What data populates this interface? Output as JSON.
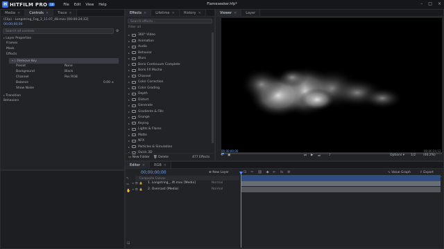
{
  "app": {
    "name": "HITFILM PRO",
    "version": "16",
    "menu": [
      "File",
      "Edit",
      "View",
      "Help"
    ],
    "project_title": "Flameseeker.hfp*"
  },
  "left_panel": {
    "tabs": [
      "Media",
      "Controls",
      "Trace"
    ],
    "clip_name": "(Clip) - Longstring_Fog_3_11.07_48.mov [00:00:24;12]",
    "timecode": "00;00;00;00",
    "search_placeholder": "Search all controls",
    "sections": [
      "Layer Properties",
      "Frames",
      "Mask",
      "Effects"
    ],
    "effect_name": "Remove Key",
    "properties": [
      {
        "label": "Preset",
        "value": "None"
      },
      {
        "label": "Background",
        "value": "Black"
      },
      {
        "label": "Channel",
        "value": "Pos RGB"
      },
      {
        "label": "Balance",
        "value": "0.00 ±"
      },
      {
        "label": "Show Noise",
        "value": ""
      }
    ],
    "transitions": "Transition",
    "behaviors": "Behaviors"
  },
  "effects_panel": {
    "tabs": [
      "Effects",
      "Lifetime",
      "History"
    ],
    "search_placeholder": "Search effects...",
    "filter": "Filter all",
    "items": [
      "360° Video",
      "Animation",
      "Audio",
      "Behavior",
      "Blurs",
      "Boris Continuum Complete",
      "Boris FX Mocha",
      "Channel",
      "Color Correction",
      "Color Grading",
      "Depth",
      "Distort",
      "Generate",
      "Gradients & Fills",
      "Grunge",
      "Keying",
      "Lights & Flares",
      "Matte",
      "NFX",
      "Particles & Simulation",
      "Quick 3D"
    ],
    "new_folder": "New Folder",
    "delete": "Delete",
    "count": "477 Effects"
  },
  "viewer": {
    "tabs": [
      "Viewer",
      "Layer"
    ],
    "time_start": "00;00;00;00",
    "time_end": "00;00;24;12",
    "options": "Options",
    "zoom": "1/2",
    "fit": "(46.2%)"
  },
  "editor": {
    "tabs": [
      "Editor",
      "RGB"
    ],
    "timecode": "00;00;00;00",
    "new_layer": "New Layer",
    "value_graph": "Value Graph",
    "export": "Export",
    "composite_label": "Composite Canvas",
    "layers": [
      {
        "name": "1. Longstring_..ift.mov [Media]",
        "blend": "Normal"
      },
      {
        "name": "2. Overcast (Media)",
        "blend": "Normal"
      }
    ]
  },
  "colors": {
    "accent": "#3a6fd8",
    "playhead": "#4f8cff",
    "panel_bg": "#222327"
  }
}
